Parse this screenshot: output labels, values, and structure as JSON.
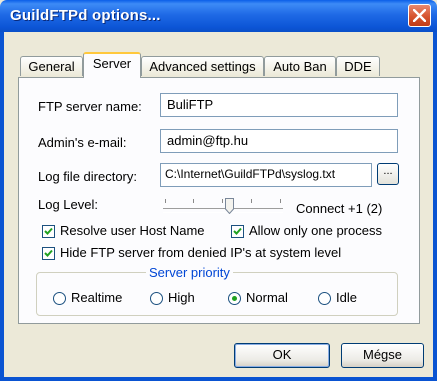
{
  "window": {
    "title": "GuildFTPd options..."
  },
  "tabs": [
    {
      "label": "General"
    },
    {
      "label": "Server"
    },
    {
      "label": "Advanced settings"
    },
    {
      "label": "Auto Ban"
    },
    {
      "label": "DDE"
    }
  ],
  "server": {
    "ftp_name_label": "FTP server name:",
    "ftp_name_value": "BuliFTP",
    "admin_email_label": "Admin's e-mail:",
    "admin_email_value": "admin@ftp.hu",
    "log_dir_label": "Log file directory:",
    "log_dir_value": "C:\\Internet\\GuildFTPd\\syslog.txt",
    "browse_label": "...",
    "log_level_label": "Log Level:",
    "log_level_value": "Connect +1 (2)",
    "log_level_position": 0.5,
    "resolve_host_label": "Resolve user Host Name",
    "resolve_host_checked": true,
    "one_process_label": "Allow only one process",
    "one_process_checked": true,
    "hide_ftp_label": "Hide FTP server from denied IP's at system level",
    "hide_ftp_checked": true
  },
  "priority": {
    "title": "Server priority",
    "options": [
      "Realtime",
      "High",
      "Normal",
      "Idle"
    ],
    "selected": "Normal"
  },
  "buttons": {
    "ok": "OK",
    "cancel": "Mégse"
  },
  "colors": {
    "titlebar": "#0a5ee8",
    "accent": "#0046d5",
    "check": "#21a121"
  }
}
